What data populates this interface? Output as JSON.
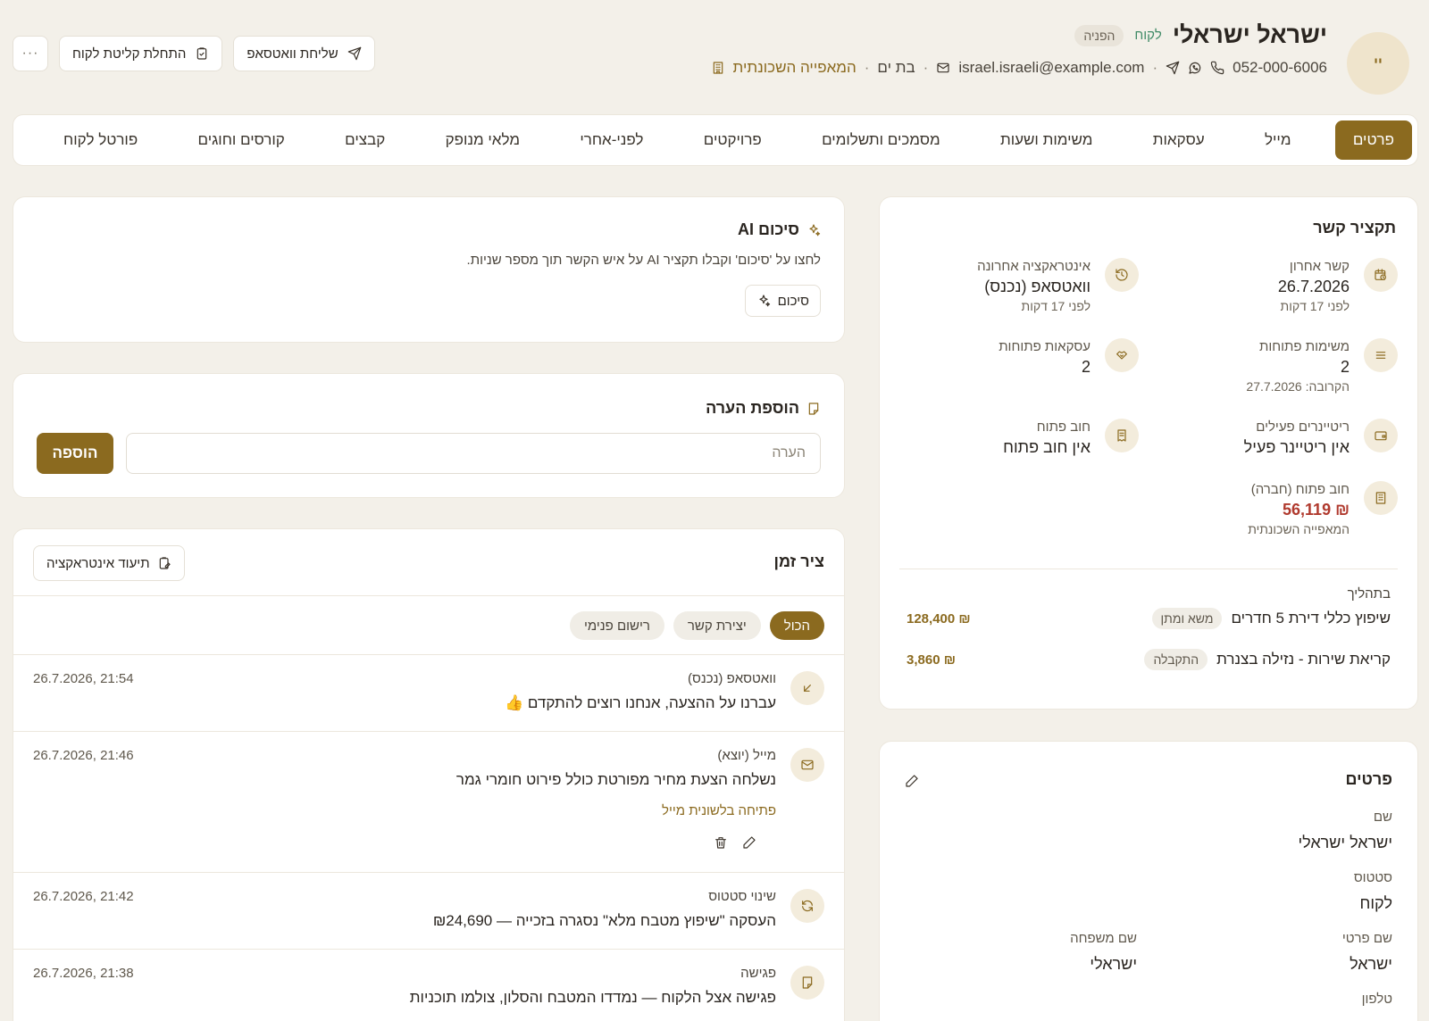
{
  "header": {
    "avatar": "יי",
    "name": "ישראל ישראלי",
    "status_tag": "לקוח",
    "referral_tag": "הפניה",
    "phone": "052-000-6006",
    "email": "israel.israeli@example.com",
    "city": "בת ים",
    "company": "המאפייה השכונתית",
    "whatsapp_button": "שליחת וואטסאפ",
    "onboarding_button": "התחלת קליטת לקוח",
    "more_button": "···"
  },
  "tabs": [
    {
      "label": "פרטים",
      "active": true
    },
    {
      "label": "מייל"
    },
    {
      "label": "עסקאות"
    },
    {
      "label": "משימות ושעות"
    },
    {
      "label": "מסמכים ותשלומים"
    },
    {
      "label": "פרויקטים"
    },
    {
      "label": "לפני-אחרי"
    },
    {
      "label": "מלאי מנופק"
    },
    {
      "label": "קבצים"
    },
    {
      "label": "קורסים וחוגים"
    },
    {
      "label": "פורטל לקוח"
    }
  ],
  "summary": {
    "title": "תקציר קשר",
    "last_contact": {
      "label": "קשר אחרון",
      "value": "26.7.2026",
      "sub": "לפני 17 דקות"
    },
    "last_interaction": {
      "label": "אינטראקציה אחרונה",
      "value": "וואטסאפ (נכנס)",
      "sub": "לפני 17 דקות"
    },
    "open_tasks": {
      "label": "משימות פתוחות",
      "value": "2",
      "sub": "הקרובה: 27.7.2026"
    },
    "open_deals": {
      "label": "עסקאות פתוחות",
      "value": "2"
    },
    "retainers": {
      "label": "ריטיינרים פעילים",
      "value": "אין ריטיינר פעיל"
    },
    "open_debt": {
      "label": "חוב פתוח",
      "value": "אין חוב פתוח"
    },
    "company_debt": {
      "label": "חוב פתוח (חברה)",
      "value": "₪ 56,119",
      "sub": "המאפייה השכונתית"
    },
    "in_progress_label": "בתהליך",
    "deals": [
      {
        "name": "שיפוץ כללי דירת 5 חדרים",
        "badge": "משא ומתן",
        "amount": "₪ 128,400"
      },
      {
        "name": "קריאת שירות - נזילה בצנרת",
        "badge": "התקבלה",
        "amount": "₪ 3,860"
      }
    ]
  },
  "details": {
    "title": "פרטים",
    "name_label": "שם",
    "name_value": "ישראל ישראלי",
    "status_label": "סטטוס",
    "status_value": "לקוח",
    "first_name_label": "שם פרטי",
    "first_name_value": "ישראל",
    "last_name_label": "שם משפחה",
    "last_name_value": "ישראלי",
    "phone_label": "טלפון"
  },
  "ai": {
    "title": "סיכום AI",
    "description": "לחצו על 'סיכום' וקבלו תקציר AI על איש הקשר תוך מספר שניות.",
    "button": "סיכום"
  },
  "note": {
    "title": "הוספת הערה",
    "placeholder": "הערה",
    "button": "הוספה"
  },
  "timeline": {
    "title": "ציר זמן",
    "document_button": "תיעוד אינטראקציה",
    "filters": [
      {
        "label": "הכול",
        "active": true
      },
      {
        "label": "יצירת קשר"
      },
      {
        "label": "רישום פנימי"
      }
    ],
    "items": [
      {
        "kind": "וואטסאפ (נכנס)",
        "text": "עברנו על ההצעה, אנחנו רוצים להתקדם 👍",
        "time": "26.7.2026, 21:54"
      },
      {
        "kind": "מייל (יוצא)",
        "text": "נשלחה הצעת מחיר מפורטת כולל פירוט חומרי גמר",
        "time": "26.7.2026, 21:46",
        "link": "פתיחה בלשונית מייל"
      },
      {
        "kind": "שינוי סטטוס",
        "text": "העסקה \"שיפוץ מטבח מלא\" נסגרה בזכייה — ₪24,690",
        "time": "26.7.2026, 21:42"
      },
      {
        "kind": "פגישה",
        "text": "פגישה אצל הלקוח — נמדדו המטבח והסלון, צולמו תוכניות",
        "time": "26.7.2026, 21:38"
      }
    ]
  },
  "colors": {
    "accent": "#8b6a1f",
    "background": "#f3f0e9",
    "debt": "#b03a2e",
    "client_tag": "#3f8a66"
  }
}
